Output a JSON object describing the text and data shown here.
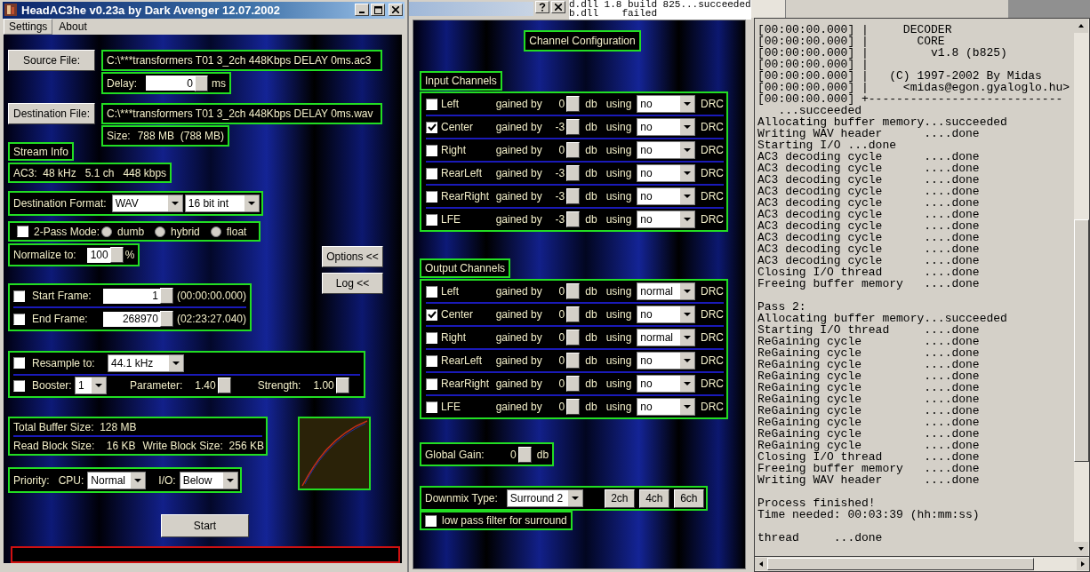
{
  "window": {
    "title": "HeadAC3he v0.23a by Dark Avenger 12.07.2002"
  },
  "menu": [
    {
      "label": "Settings"
    },
    {
      "label": "About"
    }
  ],
  "source": {
    "button": "Source File:",
    "path": "C:\\***transformers T01 3_2ch 448Kbps DELAY 0ms.ac3",
    "delay_label": "Delay:",
    "delay_value": "0",
    "delay_unit": "ms"
  },
  "destination": {
    "button": "Destination File:",
    "path": "C:\\***transformers T01 3_2ch 448Kbps DELAY 0ms.wav",
    "size_label": "Size:",
    "size_value": "788 MB  (788 MB)"
  },
  "stream_info": {
    "title": "Stream Info",
    "text": "AC3:  48 kHz   5.1 ch   448 kbps"
  },
  "format": {
    "label": "Destination Format:",
    "container": "WAV",
    "depth": "16 bit int"
  },
  "two_pass": {
    "label": "2-Pass Mode:",
    "checked": false,
    "modes": [
      {
        "label": "dumb",
        "selected": false
      },
      {
        "label": "hybrid",
        "selected": false
      },
      {
        "label": "float",
        "selected": false
      }
    ]
  },
  "normalize": {
    "label": "Normalize to:",
    "value": "100",
    "unit": "%"
  },
  "side_buttons": [
    "Options <<",
    "Log <<"
  ],
  "frames": [
    {
      "label": "Start Frame:",
      "checked": false,
      "value": "1",
      "time": "(00:00:00.000)"
    },
    {
      "label": "End Frame:",
      "checked": false,
      "value": "268970",
      "time": "(02:23:27.040)"
    }
  ],
  "resample": {
    "label": "Resample to:",
    "checked": false,
    "value": "44.1 kHz"
  },
  "booster": {
    "label": "Booster:",
    "checked": false,
    "value": "1",
    "parameter_label": "Parameter:",
    "parameter": "1.40",
    "strength_label": "Strength:",
    "strength": "1.00"
  },
  "buffers": {
    "total": "Total Buffer Size:  128 MB",
    "read": "Read Block Size:    16 KB",
    "write": "Write Block Size:  256 KB"
  },
  "priority": {
    "label": "Priority:",
    "cpu_label": "CPU:",
    "cpu": "Normal",
    "io_label": "I/O:",
    "io": "Below"
  },
  "start_button": "Start",
  "log_strip": [
    "d.dll 1.8 build 825...succeeded",
    "b.dll    failed"
  ],
  "channel_config": {
    "title": "Channel Configuration",
    "input": {
      "title": "Input Channels",
      "channels": [
        {
          "name": "Left",
          "checked": false,
          "gain_label": "gained by",
          "gain": "0",
          "unit": "db",
          "using": "using",
          "mode": "no",
          "suffix": "DRC"
        },
        {
          "name": "Center",
          "checked": true,
          "gain_label": "gained by",
          "gain": "-3",
          "unit": "db",
          "using": "using",
          "mode": "no",
          "suffix": "DRC"
        },
        {
          "name": "Right",
          "checked": false,
          "gain_label": "gained by",
          "gain": "0",
          "unit": "db",
          "using": "using",
          "mode": "no",
          "suffix": "DRC"
        },
        {
          "name": "RearLeft",
          "checked": false,
          "gain_label": "gained by",
          "gain": "-3",
          "unit": "db",
          "using": "using",
          "mode": "no",
          "suffix": "DRC"
        },
        {
          "name": "RearRight",
          "checked": false,
          "gain_label": "gained by",
          "gain": "-3",
          "unit": "db",
          "using": "using",
          "mode": "no",
          "suffix": "DRC"
        },
        {
          "name": "LFE",
          "checked": false,
          "gain_label": "gained by",
          "gain": "-3",
          "unit": "db",
          "using": "using",
          "mode": "no",
          "suffix": "DRC"
        }
      ]
    },
    "output": {
      "title": "Output Channels",
      "channels": [
        {
          "name": "Left",
          "checked": false,
          "gain_label": "gained by",
          "gain": "0",
          "unit": "db",
          "using": "using",
          "mode": "normal",
          "suffix": "DRC"
        },
        {
          "name": "Center",
          "checked": true,
          "gain_label": "gained by",
          "gain": "0",
          "unit": "db",
          "using": "using",
          "mode": "no",
          "suffix": "DRC"
        },
        {
          "name": "Right",
          "checked": false,
          "gain_label": "gained by",
          "gain": "0",
          "unit": "db",
          "using": "using",
          "mode": "normal",
          "suffix": "DRC"
        },
        {
          "name": "RearLeft",
          "checked": false,
          "gain_label": "gained by",
          "gain": "0",
          "unit": "db",
          "using": "using",
          "mode": "no",
          "suffix": "DRC"
        },
        {
          "name": "RearRight",
          "checked": false,
          "gain_label": "gained by",
          "gain": "0",
          "unit": "db",
          "using": "using",
          "mode": "no",
          "suffix": "DRC"
        },
        {
          "name": "LFE",
          "checked": false,
          "gain_label": "gained by",
          "gain": "0",
          "unit": "db",
          "using": "using",
          "mode": "no",
          "suffix": "DRC"
        }
      ]
    }
  },
  "global_gain": {
    "label": "Global Gain:",
    "value": "0",
    "unit": "db"
  },
  "downmix": {
    "label": "Downmix Type:",
    "value": "Surround 2",
    "buttons": [
      "2ch",
      "4ch",
      "6ch"
    ],
    "lowpass": {
      "label": "low pass filter for surround",
      "checked": false
    }
  },
  "log": {
    "blocks": [
      [
        "[00:00:00.000] |     DECODER",
        "[00:00:00.000] |       CORE",
        "[00:00:00.000] |         v1.8 (b825)",
        "[00:00:00.000] |",
        "[00:00:00.000] |   (C) 1997-2002 By Midas",
        "[00:00:00.000] |     <midas@egon.gyaloglo.hu>",
        "[00:00:00.000] +----------------------------",
        "   ...succeeded",
        "Allocating buffer memory...succeeded",
        "Writing WAV header      ....done",
        "Starting I/O ...done",
        "AC3 decoding cycle      ....done",
        "AC3 decoding cycle      ....done",
        "AC3 decoding cycle      ....done",
        "AC3 decoding cycle      ....done",
        "AC3 decoding cycle      ....done",
        "AC3 decoding cycle      ....done",
        "AC3 decoding cycle      ....done",
        "AC3 decoding cycle      ....done",
        "AC3 decoding cycle      ....done",
        "AC3 decoding cycle      ....done",
        "Closing I/O thread      ....done",
        "Freeing buffer memory   ....done"
      ],
      [
        "Pass 2:",
        "Allocating buffer memory...succeeded",
        "Starting I/O thread     ....done",
        "ReGaining cycle         ....done",
        "ReGaining cycle         ....done",
        "ReGaining cycle         ....done",
        "ReGaining cycle         ....done",
        "ReGaining cycle         ....done",
        "ReGaining cycle         ....done",
        "ReGaining cycle         ....done",
        "ReGaining cycle         ....done",
        "ReGaining cycle         ....done",
        "ReGaining cycle         ....done",
        "Closing I/O thread      ....done",
        "Freeing buffer memory   ....done",
        "Writing WAV header      ....done"
      ],
      [
        "Process finished!",
        "Time needed: 00:03:39 (hh:mm:ss)"
      ],
      [
        "thread     ...done"
      ]
    ]
  }
}
